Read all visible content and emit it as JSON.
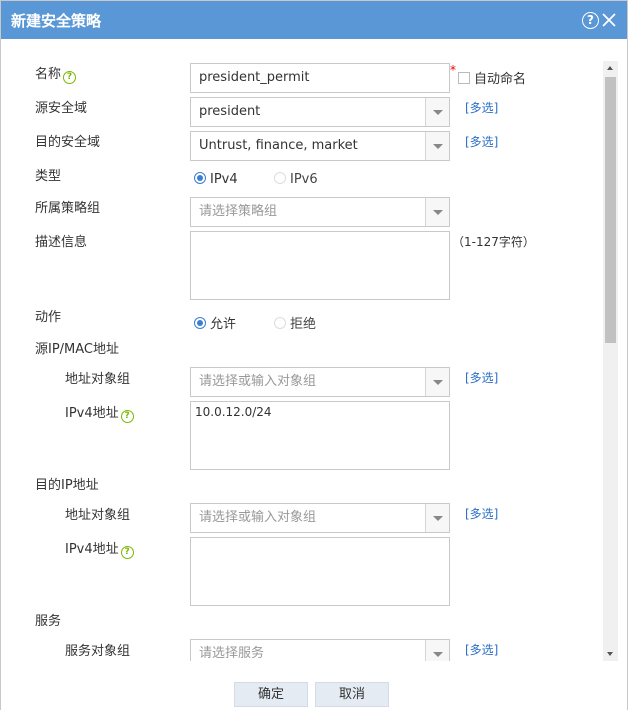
{
  "dialog": {
    "title": "新建安全策略",
    "help_glyph": "?",
    "close_glyph": "×"
  },
  "form": {
    "name": {
      "label": "名称",
      "value": "president_permit",
      "required_mark": "*",
      "auto_name_label": "自动命名"
    },
    "src_zone": {
      "label": "源安全域",
      "value": "president",
      "multi_link": "[多选]"
    },
    "dst_zone": {
      "label": "目的安全域",
      "value": "Untrust, finance, market",
      "multi_link": "[多选]"
    },
    "type": {
      "label": "类型",
      "options": [
        "IPv4",
        "IPv6"
      ],
      "selected": "IPv4"
    },
    "policy_group": {
      "label": "所属策略组",
      "placeholder": "请选择策略组"
    },
    "description": {
      "label": "描述信息",
      "hint": "（1-127字符）",
      "value": ""
    },
    "action": {
      "label": "动作",
      "options": [
        "允许",
        "拒绝"
      ],
      "selected": "允许"
    },
    "src_ip_mac": {
      "label": "源IP/MAC地址",
      "addr_group": {
        "label": "地址对象组",
        "placeholder": "请选择或输入对象组",
        "multi_link": "[多选]"
      },
      "ipv4": {
        "label": "IPv4地址",
        "value": "10.0.12.0/24"
      }
    },
    "dst_ip": {
      "label": "目的IP地址",
      "addr_group": {
        "label": "地址对象组",
        "placeholder": "请选择或输入对象组",
        "multi_link": "[多选]"
      },
      "ipv4": {
        "label": "IPv4地址",
        "value": ""
      }
    },
    "service": {
      "label": "服务",
      "svc_group": {
        "label": "服务对象组",
        "placeholder": "请选择服务",
        "multi_link": "[多选]"
      }
    }
  },
  "footer": {
    "ok_label": "确定",
    "cancel_label": "取消"
  },
  "colors": {
    "titlebar": "#5a97d6",
    "link": "#2a6fc9",
    "radio_selected": "#3b7fd0",
    "help_icon": "#7ab800",
    "required": "#e00000"
  }
}
